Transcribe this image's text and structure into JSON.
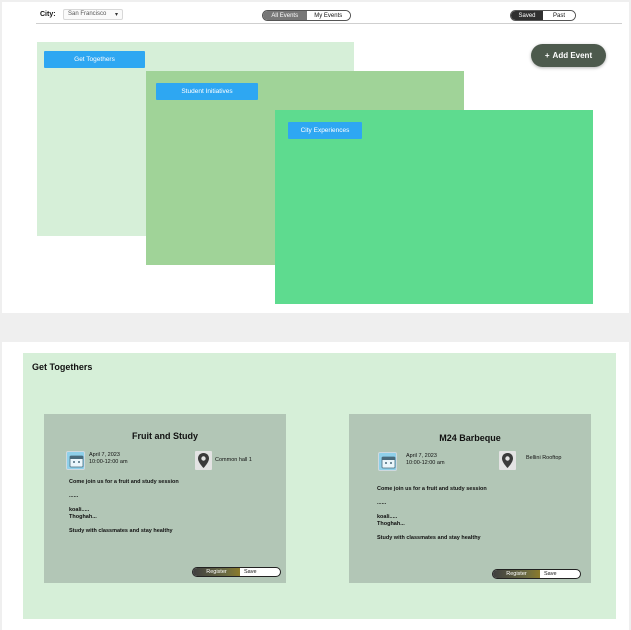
{
  "header": {
    "city_label": "City:",
    "city_value": "San Francisco",
    "events_tabs": [
      "All Events",
      "My Events"
    ],
    "active_events_tab": "All Events",
    "history_tabs": [
      "Saved",
      "Past"
    ],
    "active_history_tab": "Saved",
    "add_event_label": "Add Event"
  },
  "categories": [
    {
      "label": "Get Togethers"
    },
    {
      "label": "Student Initiatives"
    },
    {
      "label": "City Experiences"
    }
  ],
  "section": {
    "title": "Get Togethers",
    "events": [
      {
        "title": "Fruit and Study",
        "date": "April 7, 2023",
        "time": "10:00-12:00 am",
        "location": "Common hall 1",
        "body": "Come join us for a fruit and study session\n\n......\n\nkoali.....\nThoghah...\n\nStudy with classmates and stay healthy",
        "register_label": "Register",
        "save_label": "Save"
      },
      {
        "title": "M24 Barbeque",
        "date": "April 7, 2023",
        "time": "10:00-12:00 am",
        "location": "Bellini Rooftop",
        "body": "Come join us for a fruit and study session\n\n......\n\nkoali.....\nThoghah...\n\nStudy with classmates and stay healthy",
        "register_label": "Register",
        "save_label": "Save"
      }
    ]
  },
  "colors": {
    "category_1": "#d6efd8",
    "category_2": "#a0d398",
    "category_3": "#5edb8f",
    "category_button": "#2ea7f2",
    "event_card": "#b2c6b6",
    "add_event_button": "#4d5a4d"
  }
}
